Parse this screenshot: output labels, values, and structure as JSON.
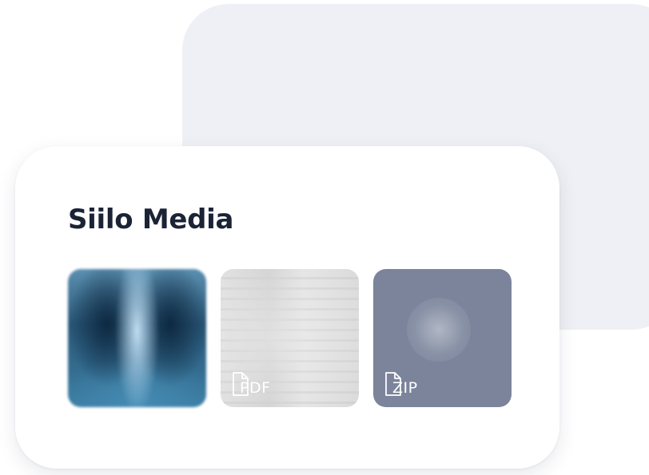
{
  "widget": {
    "title": "Siilo Media"
  },
  "media": [
    {
      "kind": "image",
      "icon": "xray-image-thumbnail"
    },
    {
      "kind": "pdf",
      "label": "PDF",
      "icon": "document-icon"
    },
    {
      "kind": "zip",
      "label": "ZIP",
      "icon": "document-icon"
    }
  ],
  "colors": {
    "panel": "#eff0f5",
    "card": "#ffffff",
    "title": "#1b2336",
    "zip_tile": "#7b849b"
  }
}
